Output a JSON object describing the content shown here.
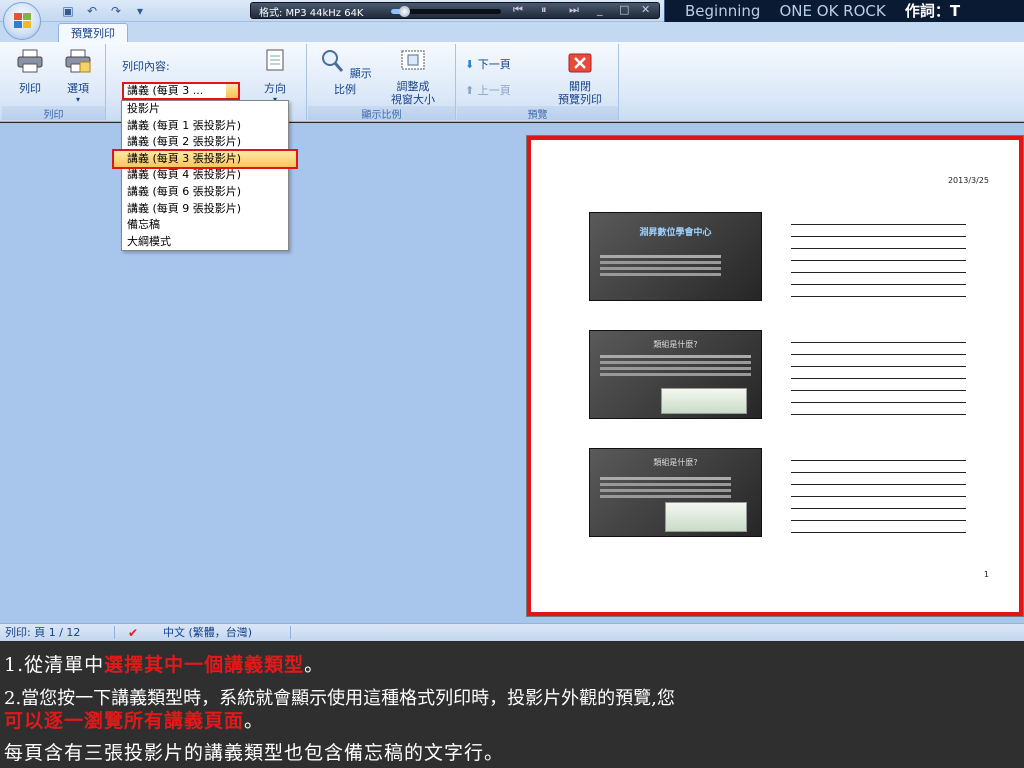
{
  "titlebar": {
    "player_format": "格式: MP3 44kHz 64K",
    "player_progress": 0.12,
    "lyrics_song": "Beginning",
    "lyrics_artist": "ONE OK ROCK",
    "lyrics_credit": "作詞：T"
  },
  "tabs": {
    "active": "預覽列印"
  },
  "ribbon": {
    "print_label": "列印",
    "options_label": "選項",
    "print_what_label": "列印內容:",
    "print_what_value": "講義 (每頁 3 ...",
    "orientation_label": "方向",
    "zoom_label": "顯示比例",
    "fit_label_1": "調整成",
    "fit_label_2": "視窗大小",
    "next_page": "下一頁",
    "prev_page": "上一頁",
    "close_label_1": "關閉",
    "close_label_2": "預覽列印",
    "group_print": "列印",
    "group_zoom": "顯示比例",
    "group_preview": "預覽"
  },
  "dropdown": {
    "items": [
      "投影片",
      "講義 (每頁 1 張投影片)",
      "講義 (每頁 2 張投影片)",
      "講義 (每頁 3 張投影片)",
      "講義 (每頁 4 張投影片)",
      "講義 (每頁 6 張投影片)",
      "講義 (每頁 9 張投影片)",
      "備忘稿",
      "大綱模式"
    ],
    "selected_index": 3
  },
  "preview": {
    "date": "2013/3/25",
    "page_number": "1",
    "slide1_title": "淵昇數位學會中心",
    "slide2_title": "類組是什麼?",
    "slide3_title": "類組是什麼?"
  },
  "status": {
    "page": "列印: 頁 1 / 12",
    "language": "中文 (繁體，台灣)"
  },
  "caption": {
    "l1_a": "1.從清單中",
    "l1_b": "選擇其中一個講義類型",
    "l1_c": "。",
    "l2_a": "2.當您按一下講義類型時，系統就會顯示使用這種格式列印時，投影片外觀的預覽,您",
    "l3_a": "可以逐一瀏覽所有講義頁面",
    "l3_b": "。",
    "l4": "每頁含有三張投影片的講義類型也包含備忘稿的文字行。"
  },
  "colors": {
    "highlight": "#e01515",
    "ribbon": "#dbe8f7",
    "workspace": "#a8c5ec"
  }
}
